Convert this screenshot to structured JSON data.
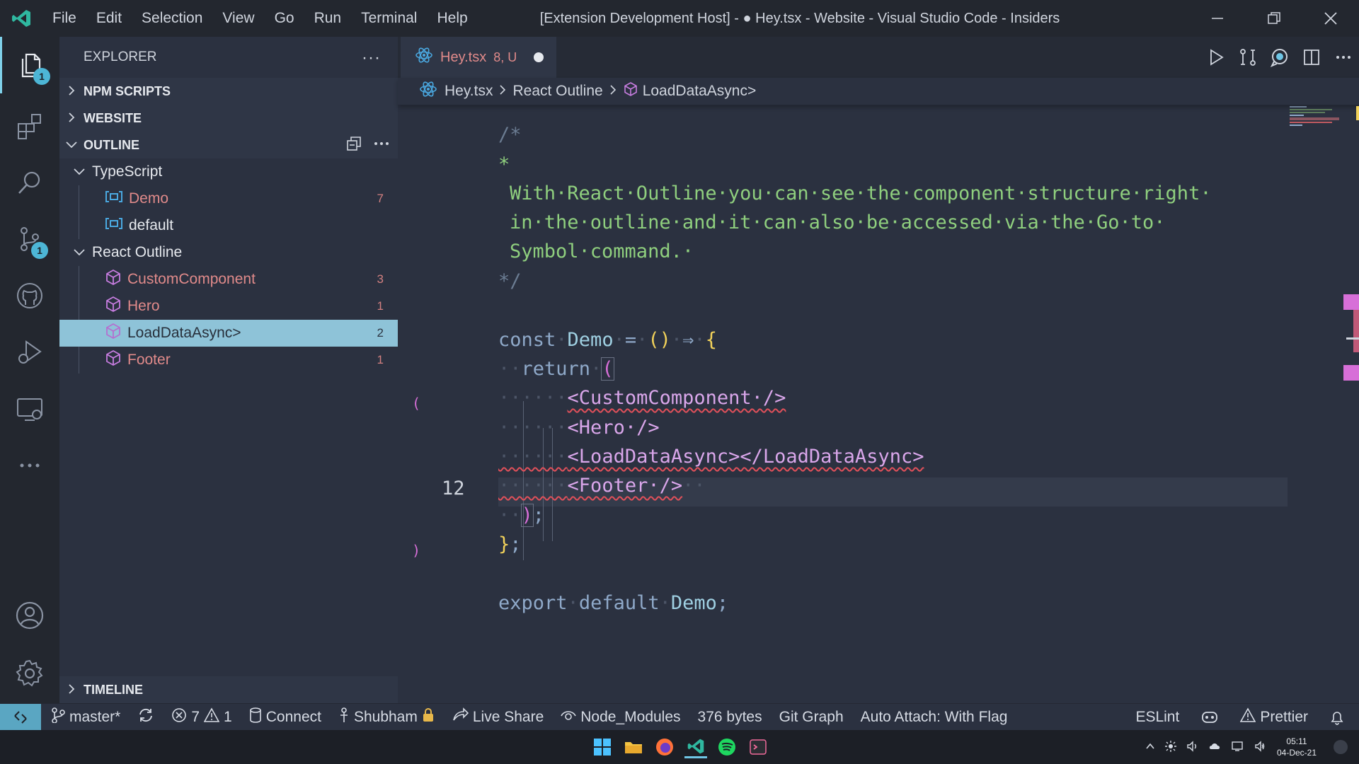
{
  "window": {
    "title": "[Extension Development Host] - ● Hey.tsx - Website - Visual Studio Code - Insiders",
    "menu": [
      "File",
      "Edit",
      "Selection",
      "View",
      "Go",
      "Run",
      "Terminal",
      "Help"
    ]
  },
  "activity": {
    "explorer_badge": "1",
    "scm_badge": "1"
  },
  "sidebar": {
    "title": "EXPLORER",
    "more": "···",
    "sections": {
      "npm": "NPM SCRIPTS",
      "website": "WEBSITE",
      "outline": "OUTLINE",
      "timeline": "TIMELINE"
    },
    "outline": {
      "groups": [
        {
          "label": "TypeScript",
          "items": [
            {
              "label": "Demo",
              "count": "7"
            },
            {
              "label": "default",
              "count": ""
            }
          ]
        },
        {
          "label": "React Outline",
          "items": [
            {
              "label": "CustomComponent",
              "count": "3"
            },
            {
              "label": "Hero",
              "count": "1"
            },
            {
              "label": "LoadDataAsync>",
              "count": "2"
            },
            {
              "label": "Footer",
              "count": "1"
            }
          ]
        }
      ]
    }
  },
  "editor": {
    "tab": {
      "name": "Hey.tsx",
      "meta": "8, U"
    },
    "breadcrumb": [
      "Hey.tsx",
      "React Outline",
      "LoadDataAsync>"
    ],
    "current_line": "12",
    "gutter_open": "(",
    "gutter_close": ")",
    "code": {
      "c1": "/*",
      "c2": "*",
      "c3": "With·React·Outline·you·can·see·the·component·structure·right·",
      "c4": "in·the·outline·and·it·can·also·be·accessed·via·the·Go·to·",
      "c5": "Symbol·command.·",
      "c6": "*/",
      "l1_kw": "const",
      "l1_id": "Demo",
      "l1_eq": "=",
      "l1_p": "()",
      "l1_arrow": "⇒",
      "l1_b": "{",
      "l2_kw": "return",
      "l2_p": "(",
      "l3": "<CustomComponent·/>",
      "l4": "<Hero·/>",
      "l5": "<LoadDataAsync></LoadDataAsync>",
      "l6": "<Footer·/>",
      "l7_p": ")",
      "l7_s": ";",
      "l8_b": "}",
      "l8_s": ";",
      "l9_kw": "export",
      "l9_kw2": "default",
      "l9_id": "Demo",
      "l9_s": ";"
    }
  },
  "status": {
    "branch": "master*",
    "errors": "7",
    "warnings": "1",
    "connect": "Connect",
    "user": "Shubham",
    "liveshare": "Live Share",
    "nodemodules": "Node_Modules",
    "size": "376 bytes",
    "gitgraph": "Git Graph",
    "autoattach": "Auto Attach: With Flag",
    "eslint": "ESLint",
    "prettier": "Prettier"
  },
  "taskbar": {
    "time": "05:11",
    "date": "04-Dec-21"
  }
}
